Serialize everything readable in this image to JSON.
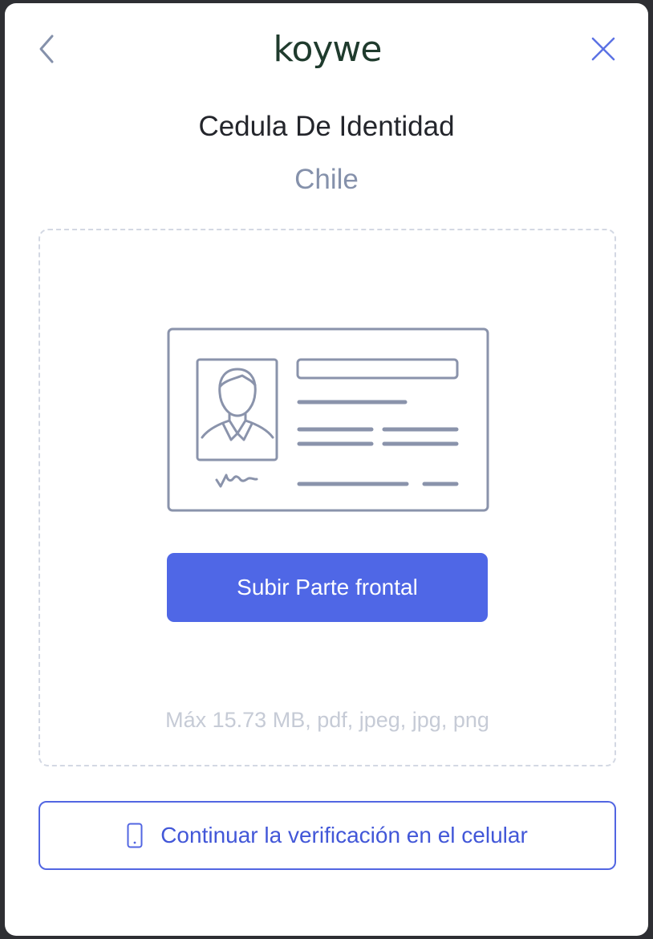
{
  "brand": {
    "logo_text": "koywe",
    "logo_color": "#1f3b2d"
  },
  "header": {
    "back_icon": "chevron-left-icon",
    "close_icon": "close-icon"
  },
  "document": {
    "title": "Cedula De Identidad",
    "country": "Chile"
  },
  "upload": {
    "illustration_icon": "id-card-icon",
    "button_label": "Subir Parte frontal",
    "hint": "Máx 15.73 MB, pdf, jpeg, jpg, png"
  },
  "mobile": {
    "icon": "smartphone-icon",
    "button_label": "Continuar la verificación en el celular"
  },
  "colors": {
    "accent": "#4f67e6",
    "muted_text": "#8591ab",
    "hint_text": "#c6cbd6",
    "illustration_stroke": "#8a93ab"
  }
}
